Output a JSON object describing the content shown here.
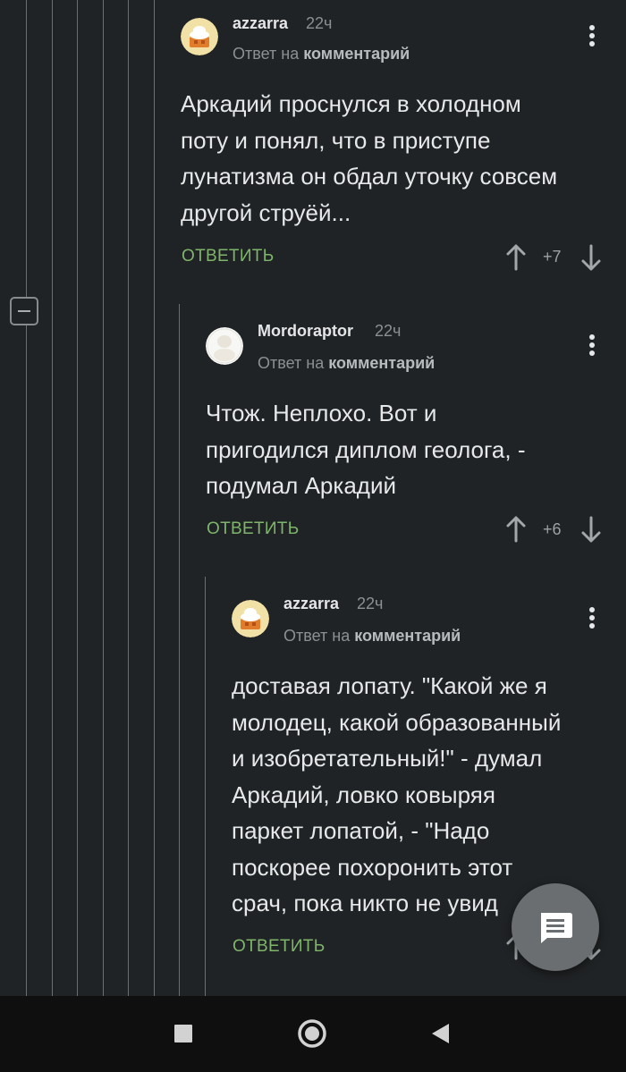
{
  "comments": [
    {
      "username": "azzarra",
      "time": "22ч",
      "reply_prefix": "Ответ на",
      "reply_link": "комментарий",
      "lines": [
        "Аркадий проснулся в холодном",
        "поту и понял, что в приступе",
        "лунатизма он обдал уточку совсем",
        "другой струёй..."
      ],
      "reply_label": "ОТВЕТИТЬ",
      "score": "+7"
    },
    {
      "username": "Mordoraptor",
      "time": "22ч",
      "reply_prefix": "Ответ на",
      "reply_link": "комментарий",
      "lines": [
        "Чтож. Неплохо. Вот и",
        "пригодился диплом геолога, -",
        "подумал Аркадий"
      ],
      "reply_label": "ОТВЕТИТЬ",
      "score": "+6"
    },
    {
      "username": "azzarra",
      "time": "22ч",
      "reply_prefix": "Ответ на",
      "reply_link": "комментарий",
      "lines": [
        "доставая лопату. \"Какой же я",
        "молодец, какой образованный",
        "и изобретательный!\" - думал",
        "Аркадий, ловко ковыряя",
        "паркет лопатой, - \"Надо",
        "поскорее похоронить этот",
        "срач, пока никто не увид"
      ],
      "reply_label": "ОТВЕТИТЬ"
    }
  ],
  "icons": {
    "collapse": "minus-square-icon",
    "more": "more-vertical-icon",
    "upvote": "arrow-up-icon",
    "downvote": "arrow-down-icon",
    "fab": "comment-icon",
    "nav_recent": "square-icon",
    "nav_home": "circle-icon",
    "nav_back": "triangle-left-icon"
  },
  "colors": {
    "background": "#202325",
    "reply_button": "#7fb56a",
    "username": "#e3e5e6",
    "meta": "#8c9093",
    "nav_bar": "#0f0f0f"
  }
}
